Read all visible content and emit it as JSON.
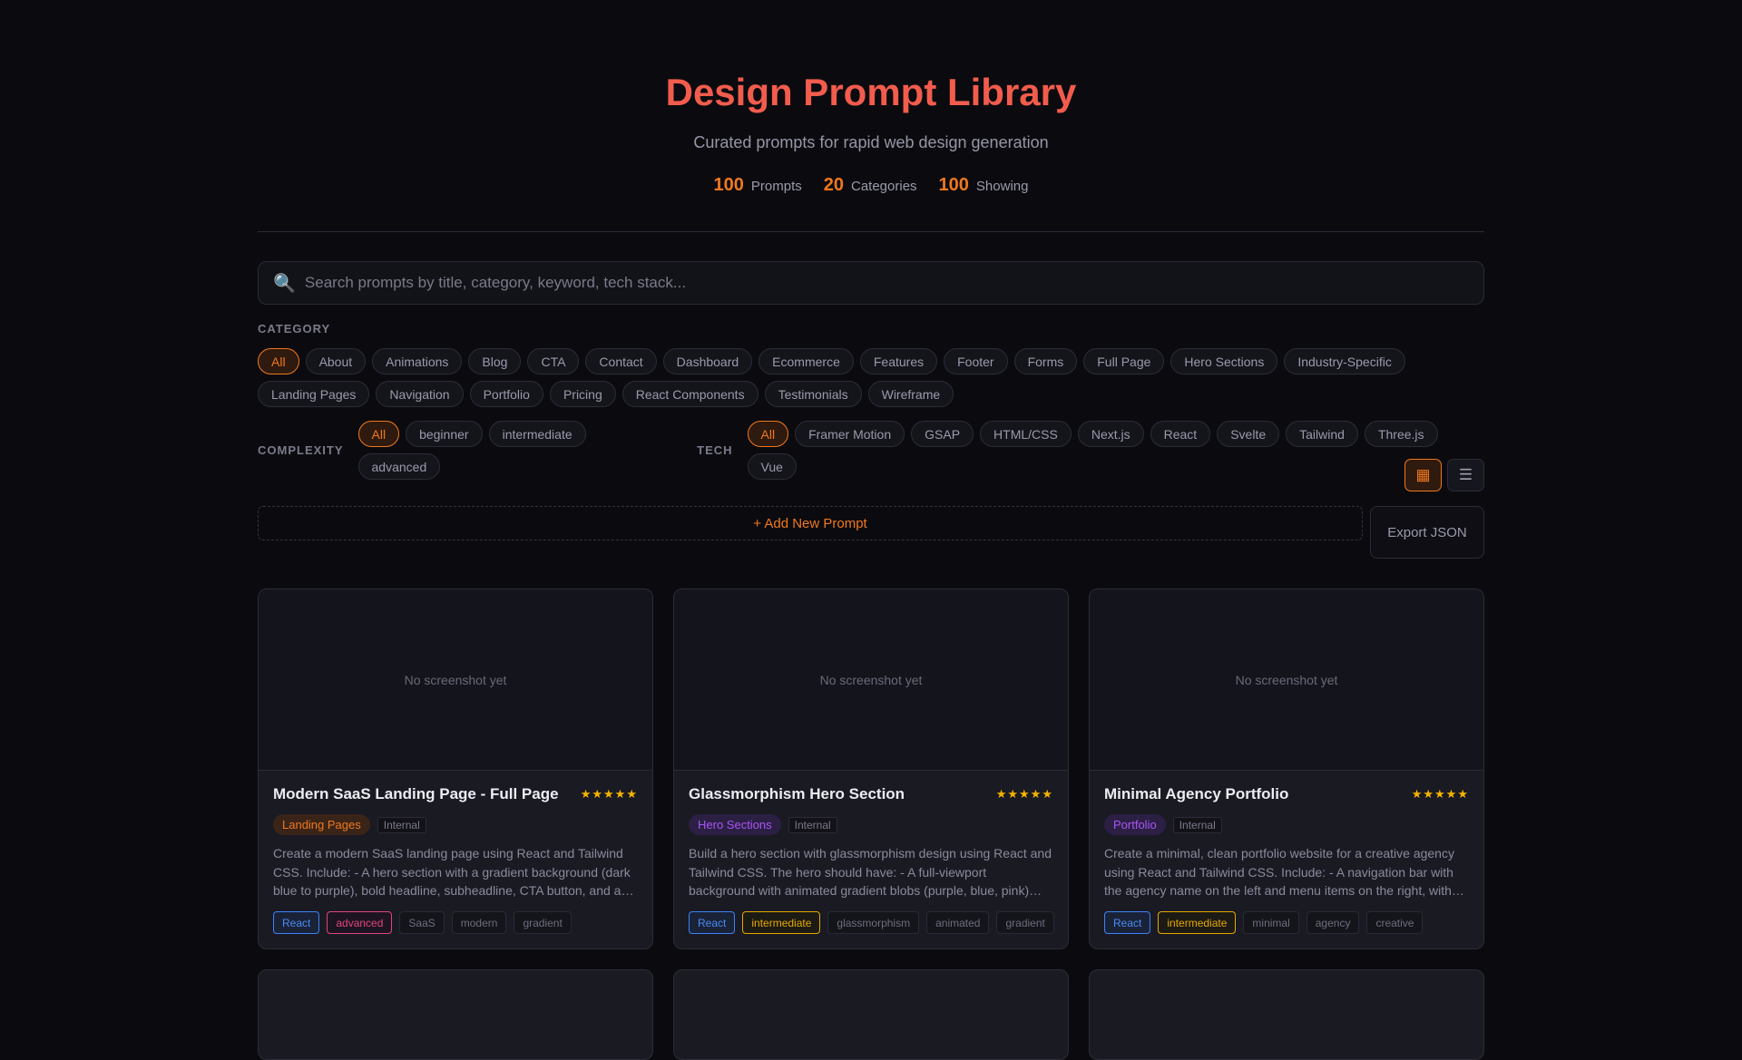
{
  "header": {
    "title": "Design Prompt Library",
    "subtitle": "Curated prompts for rapid web design generation",
    "stats": [
      {
        "n": "100",
        "l": "Prompts"
      },
      {
        "n": "20",
        "l": "Categories"
      },
      {
        "n": "100",
        "l": "Showing"
      }
    ]
  },
  "search": {
    "placeholder": "Search prompts by title, category, keyword, tech stack..."
  },
  "filters": {
    "category_label": "CATEGORY",
    "categories": [
      "All",
      "About",
      "Animations",
      "Blog",
      "CTA",
      "Contact",
      "Dashboard",
      "Ecommerce",
      "Features",
      "Footer",
      "Forms",
      "Full Page",
      "Hero Sections",
      "Industry-Specific",
      "Landing Pages",
      "Navigation",
      "Portfolio",
      "Pricing",
      "React Components",
      "Testimonials",
      "Wireframe"
    ],
    "complexity_label": "COMPLEXITY",
    "complexity": [
      "All",
      "beginner",
      "intermediate",
      "advanced"
    ],
    "tech_label": "TECH",
    "tech": [
      "All",
      "Framer Motion",
      "GSAP",
      "HTML/CSS",
      "Next.js",
      "React",
      "Svelte",
      "Tailwind",
      "Three.js",
      "Vue"
    ]
  },
  "actions": {
    "add": "+ Add New Prompt",
    "export": "Export JSON",
    "grid_icon": "▦",
    "list_icon": "☰"
  },
  "cards": [
    {
      "placeholder": "No screenshot yet",
      "title": "Modern SaaS Landing Page - Full Page",
      "stars": "★★★★★",
      "category": "Landing Pages",
      "cat_color": "#f0781e",
      "cat_bg": "#3a2418",
      "source": "Internal",
      "desc": "Create a modern SaaS landing page using React and Tailwind CSS. Include: - A hero section with a gradient background (dark blue to purple), bold headline, subheadline, CTA button, and a…",
      "tech": "React",
      "complexity": "advanced",
      "keywords": [
        "SaaS",
        "modern",
        "gradient"
      ]
    },
    {
      "placeholder": "No screenshot yet",
      "title": "Glassmorphism Hero Section",
      "stars": "★★★★★",
      "category": "Hero Sections",
      "cat_color": "#a855f7",
      "cat_bg": "#2c1f44",
      "source": "Internal",
      "desc": "Build a hero section with glassmorphism design using React and Tailwind CSS. The hero should have: - A full-viewport background with animated gradient blobs (purple, blue, pink) slowly moving - …",
      "tech": "React",
      "complexity": "intermediate",
      "keywords": [
        "glassmorphism",
        "animated",
        "gradient"
      ]
    },
    {
      "placeholder": "No screenshot yet",
      "title": "Minimal Agency Portfolio",
      "stars": "★★★★★",
      "category": "Portfolio",
      "cat_color": "#a855f7",
      "cat_bg": "#2c1f44",
      "source": "Internal",
      "desc": "Create a minimal, clean portfolio website for a creative agency using React and Tailwind CSS. Include: - A navigation bar with the agency name on the left and menu items on the right, with a…",
      "tech": "React",
      "complexity": "intermediate",
      "keywords": [
        "minimal",
        "agency",
        "creative"
      ]
    }
  ]
}
